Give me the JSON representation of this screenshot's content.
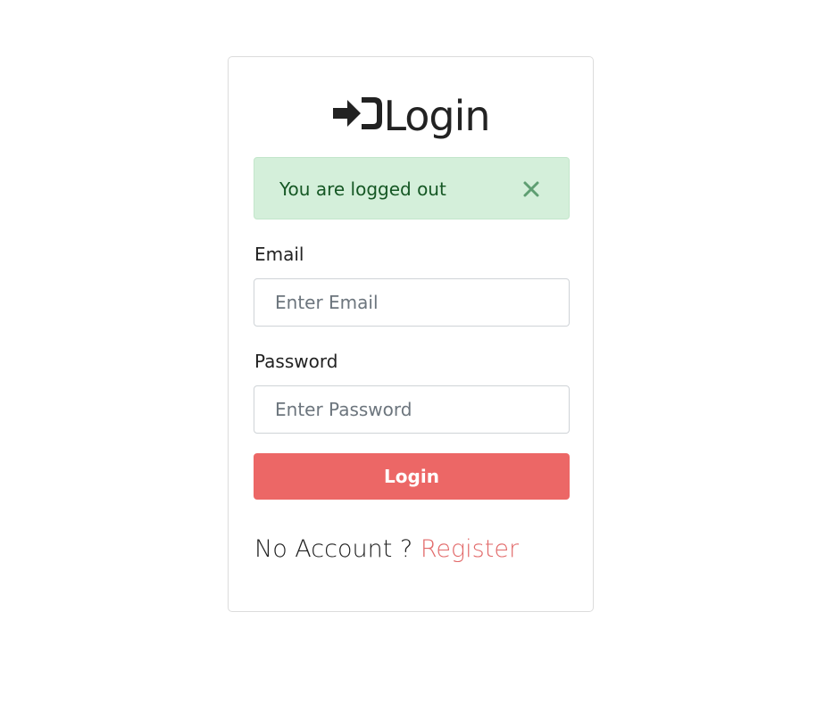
{
  "login_card": {
    "title": "Login",
    "title_icon": "sign-in-icon",
    "alert": {
      "message": "You are logged out",
      "close_label": "×",
      "close_icon": "close-icon",
      "bg_color": "#d4efda",
      "text_color": "#155724"
    },
    "email": {
      "label": "Email",
      "placeholder": "Enter Email",
      "value": ""
    },
    "password": {
      "label": "Password",
      "placeholder": "Enter Password",
      "value": ""
    },
    "submit_label": "Login",
    "submit_color": "#ec6766",
    "footer": {
      "prompt": "No Account ? ",
      "link_label": "Register",
      "link_color": "#e26a6a"
    }
  }
}
